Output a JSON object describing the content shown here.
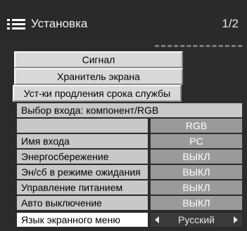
{
  "header": {
    "title": "Установка",
    "page": "1/2",
    "icon": "menu-list-icon"
  },
  "buttons": [
    {
      "label": "Сигнал"
    },
    {
      "label": "Хранитель экрана"
    },
    {
      "label": "Уст-ки продления срока службы"
    }
  ],
  "rows": [
    {
      "label": "Выбор входа: компонент/RGB"
    },
    {
      "label": "",
      "value": "RGB"
    },
    {
      "label": "Имя входа",
      "value": "PC"
    },
    {
      "label": "Энергосбережение",
      "value": "ВЫКЛ"
    },
    {
      "label": "Эн/сб в режиме ожидания",
      "value": "ВЫКЛ"
    },
    {
      "label": "Управление питанием",
      "value": "ВЫКЛ"
    },
    {
      "label": "Авто выключение",
      "value": "ВЫКЛ"
    },
    {
      "label": "Язык экранного меню",
      "value": "Русский"
    }
  ]
}
